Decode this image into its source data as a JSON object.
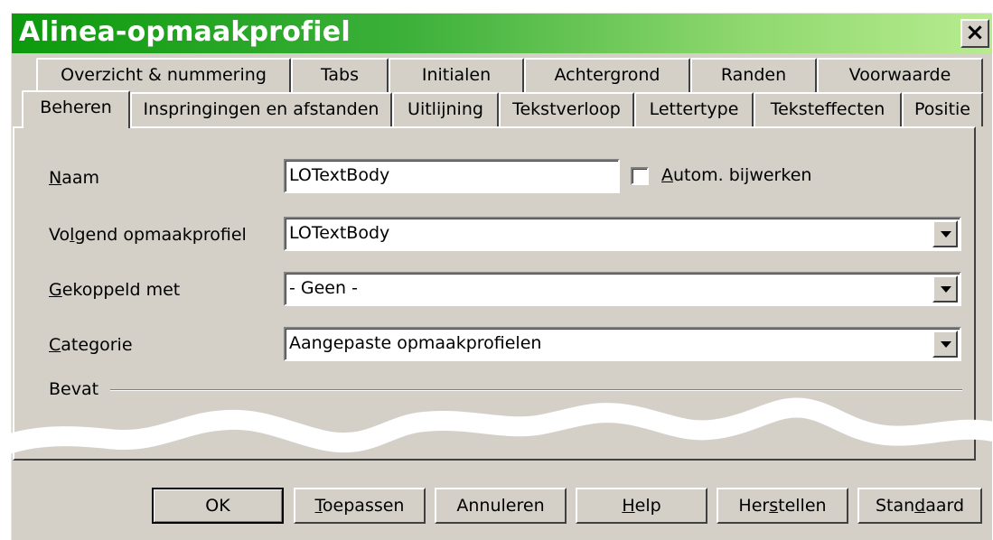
{
  "window": {
    "title": "Alinea-opmaakprofiel",
    "close_label": "×"
  },
  "tabs_row1": [
    "Overzicht & nummering",
    "Tabs",
    "Initialen",
    "Achtergrond",
    "Randen",
    "Voorwaarde"
  ],
  "tabs_row2": [
    "Beheren",
    "Inspringingen en afstanden",
    "Uitlijning",
    "Tekstverloop",
    "Lettertype",
    "Teksteffecten",
    "Positie"
  ],
  "active_tab": "Beheren",
  "form": {
    "name_label_first": "N",
    "name_label_rest": "aam",
    "name_value": "LOTextBody",
    "autoupdate_label_first": "A",
    "autoupdate_label_rest": "utom. bijwerken",
    "autoupdate_checked": false,
    "next_label_pre": "Vo",
    "next_label_u": "l",
    "next_label_post": "gend opmaakprofiel",
    "next_value": "LOTextBody",
    "linked_label_first": "G",
    "linked_label_rest": "ekoppeld met",
    "linked_value": "- Geen -",
    "category_label_first": "C",
    "category_label_rest": "ategorie",
    "category_value": "Aangepaste opmaakprofielen",
    "contains_label": "Bevat"
  },
  "buttons": {
    "ok": "OK",
    "apply_first": "T",
    "apply_rest": "oepassen",
    "cancel": "Annuleren",
    "help_first": "H",
    "help_rest": "elp",
    "reset_pre": "Her",
    "reset_u": "s",
    "reset_post": "tellen",
    "standard_pre": "Stan",
    "standard_u": "d",
    "standard_post": "aard"
  }
}
